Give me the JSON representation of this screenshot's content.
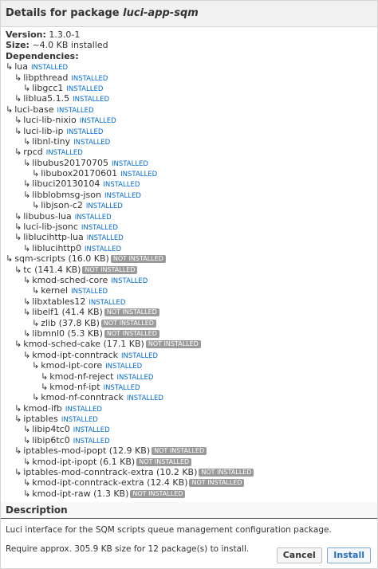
{
  "dialog": {
    "title_prefix": "Details for package ",
    "package_name": "luci-app-sqm",
    "version_label": "Version:",
    "version_value": "1.3.0-1",
    "size_label": "Size:",
    "size_value": "~4.0 KB installed",
    "deps_label": "Dependencies:"
  },
  "dependencies": [
    {
      "level": 0,
      "name": "lua",
      "status": "INSTALLED",
      "installed": true
    },
    {
      "level": 1,
      "name": "libpthread",
      "status": "INSTALLED",
      "installed": true
    },
    {
      "level": 2,
      "name": "libgcc1",
      "status": "INSTALLED",
      "installed": true
    },
    {
      "level": 1,
      "name": "liblua5.1.5",
      "status": "INSTALLED",
      "installed": true
    },
    {
      "level": 0,
      "name": "luci-base",
      "status": "INSTALLED",
      "installed": true
    },
    {
      "level": 1,
      "name": "luci-lib-nixio",
      "status": "INSTALLED",
      "installed": true
    },
    {
      "level": 1,
      "name": "luci-lib-ip",
      "status": "INSTALLED",
      "installed": true
    },
    {
      "level": 2,
      "name": "libnl-tiny",
      "status": "INSTALLED",
      "installed": true
    },
    {
      "level": 1,
      "name": "rpcd",
      "status": "INSTALLED",
      "installed": true
    },
    {
      "level": 2,
      "name": "libubus20170705",
      "status": "INSTALLED",
      "installed": true
    },
    {
      "level": 3,
      "name": "libubox20170601",
      "status": "INSTALLED",
      "installed": true
    },
    {
      "level": 2,
      "name": "libuci20130104",
      "status": "INSTALLED",
      "installed": true
    },
    {
      "level": 2,
      "name": "libblobmsg-json",
      "status": "INSTALLED",
      "installed": true
    },
    {
      "level": 3,
      "name": "libjson-c2",
      "status": "INSTALLED",
      "installed": true
    },
    {
      "level": 1,
      "name": "libubus-lua",
      "status": "INSTALLED",
      "installed": true
    },
    {
      "level": 1,
      "name": "luci-lib-jsonc",
      "status": "INSTALLED",
      "installed": true
    },
    {
      "level": 1,
      "name": "liblucihttp-lua",
      "status": "INSTALLED",
      "installed": true
    },
    {
      "level": 2,
      "name": "liblucihttp0",
      "status": "INSTALLED",
      "installed": true
    },
    {
      "level": 0,
      "name": "sqm-scripts (16.0 KB)",
      "status": "NOT INSTALLED",
      "installed": false
    },
    {
      "level": 1,
      "name": "tc (141.4 KB)",
      "status": "NOT INSTALLED",
      "installed": false
    },
    {
      "level": 2,
      "name": "kmod-sched-core",
      "status": "INSTALLED",
      "installed": true
    },
    {
      "level": 3,
      "name": "kernel",
      "status": "INSTALLED",
      "installed": true
    },
    {
      "level": 2,
      "name": "libxtables12",
      "status": "INSTALLED",
      "installed": true
    },
    {
      "level": 2,
      "name": "libelf1 (41.4 KB)",
      "status": "NOT INSTALLED",
      "installed": false
    },
    {
      "level": 3,
      "name": "zlib (37.8 KB)",
      "status": "NOT INSTALLED",
      "installed": false
    },
    {
      "level": 2,
      "name": "libmnl0 (5.3 KB)",
      "status": "NOT INSTALLED",
      "installed": false
    },
    {
      "level": 1,
      "name": "kmod-sched-cake (17.1 KB)",
      "status": "NOT INSTALLED",
      "installed": false
    },
    {
      "level": 2,
      "name": "kmod-ipt-conntrack",
      "status": "INSTALLED",
      "installed": true
    },
    {
      "level": 3,
      "name": "kmod-ipt-core",
      "status": "INSTALLED",
      "installed": true
    },
    {
      "level": 4,
      "name": "kmod-nf-reject",
      "status": "INSTALLED",
      "installed": true
    },
    {
      "level": 4,
      "name": "kmod-nf-ipt",
      "status": "INSTALLED",
      "installed": true
    },
    {
      "level": 3,
      "name": "kmod-nf-conntrack",
      "status": "INSTALLED",
      "installed": true
    },
    {
      "level": 1,
      "name": "kmod-ifb",
      "status": "INSTALLED",
      "installed": true
    },
    {
      "level": 1,
      "name": "iptables",
      "status": "INSTALLED",
      "installed": true
    },
    {
      "level": 2,
      "name": "libip4tc0",
      "status": "INSTALLED",
      "installed": true
    },
    {
      "level": 2,
      "name": "libip6tc0",
      "status": "INSTALLED",
      "installed": true
    },
    {
      "level": 1,
      "name": "iptables-mod-ipopt (12.9 KB)",
      "status": "NOT INSTALLED",
      "installed": false
    },
    {
      "level": 2,
      "name": "kmod-ipt-ipopt (6.1 KB)",
      "status": "NOT INSTALLED",
      "installed": false
    },
    {
      "level": 1,
      "name": "iptables-mod-conntrack-extra (10.2 KB)",
      "status": "NOT INSTALLED",
      "installed": false
    },
    {
      "level": 2,
      "name": "kmod-ipt-conntrack-extra (12.4 KB)",
      "status": "NOT INSTALLED",
      "installed": false
    },
    {
      "level": 2,
      "name": "kmod-ipt-raw (1.3 KB)",
      "status": "NOT INSTALLED",
      "installed": false
    }
  ],
  "description": {
    "title": "Description",
    "text": "Luci interface for the SQM scripts queue management configuration package.",
    "requirement": "Require approx. 305.9 KB size for 12 package(s) to install."
  },
  "buttons": {
    "cancel": "Cancel",
    "install": "Install"
  }
}
